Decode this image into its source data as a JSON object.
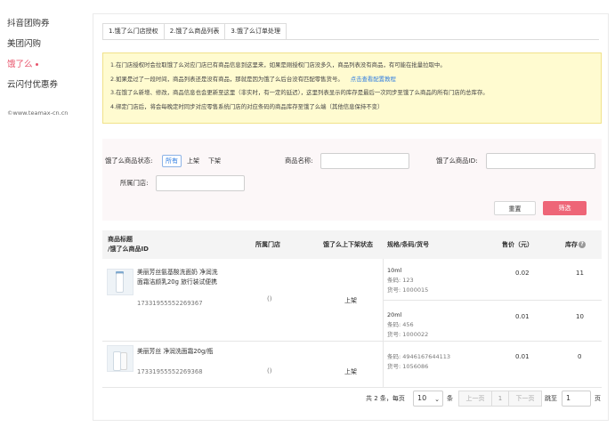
{
  "sidebar": {
    "items": [
      {
        "label": "抖音团购券",
        "active": false
      },
      {
        "label": "美团闪购",
        "active": false
      },
      {
        "label": "饿了么",
        "active": true
      },
      {
        "label": "云闪付优惠券",
        "active": false
      }
    ],
    "copyright": "©www.teamax-cn.cn"
  },
  "tabs": [
    {
      "label": "1.饿了么门店授权",
      "active": false
    },
    {
      "label": "2.饿了么商品列表",
      "active": true
    },
    {
      "label": "3.饿了么订单处理",
      "active": false
    }
  ],
  "notice": {
    "line1": "1.在门店授权时会拉取饿了么对应门店已有商品信息到这里来，如果是刚授权门店没多久，商品列表没有商品，有可能在批量拉取中。",
    "line2": "2.如果是过了一段时间，商品列表还是没有商品，那就是因为饿了么后台没有匹配零售货号。",
    "line2_link": "点击查看配置教程",
    "line3": "3.在饿了么新增、修改，商品信息也会更新至这里（非实时，有一定的延迟），这里列表显示的库存是最后一次同步至饿了么商品的所有门店的总库存。",
    "line4": "4.绑定门店后，将会每晚定时同步对应零售系统门店的对应条码的商品库存至饿了么端（其他信息保持不变）"
  },
  "filter": {
    "status_label": "饿了么商品状态:",
    "status_options": [
      "所有",
      "上架",
      "下架"
    ],
    "status_selected": "所有",
    "name_label": "商品名称:",
    "name_value": "",
    "id_label": "饿了么商品ID:",
    "id_value": "",
    "store_label": "所属门店:",
    "store_value": "",
    "reset_label": "重置",
    "filter_label": "筛选"
  },
  "table": {
    "headers": {
      "title_line1": "商品标题",
      "title_line2": "/饿了么商品ID",
      "store": "所属门店",
      "status": "饿了么上下架状态",
      "spec": "规格/条码/货号",
      "price": "售价（元）",
      "stock": "库存"
    },
    "rows": [
      {
        "title": "美丽芳丝氨基酸洗面奶 净润洗面霜洁颜乳20g 旅行装试便携",
        "id": "17331955552269367",
        "store": "()",
        "status": "上架",
        "skus": [
          {
            "spec": "10ml",
            "barcode_label": "条码:",
            "barcode": "123",
            "sku_label": "货号:",
            "sku": "1000015",
            "price": "0.02",
            "stock": "11"
          },
          {
            "spec": "20ml",
            "barcode_label": "条码:",
            "barcode": "456",
            "sku_label": "货号:",
            "sku": "1000022",
            "price": "0.01",
            "stock": "10"
          }
        ]
      },
      {
        "title": "美丽芳丝 净润洗面霜20g/瓶",
        "id": "17331955552269368",
        "store": "()",
        "status": "上架",
        "skus": [
          {
            "spec": "",
            "barcode_label": "条码:",
            "barcode": "4946167644113",
            "sku_label": "货号:",
            "sku": "1056086",
            "price": "0.01",
            "stock": "0"
          }
        ]
      }
    ]
  },
  "pagination": {
    "total_text": "共 2 条，每页",
    "page_size": "10",
    "unit": "条",
    "prev": "上一页",
    "current": "1",
    "next": "下一页",
    "jump_label": "跳至",
    "jump_value": "1",
    "page_unit": "页"
  }
}
